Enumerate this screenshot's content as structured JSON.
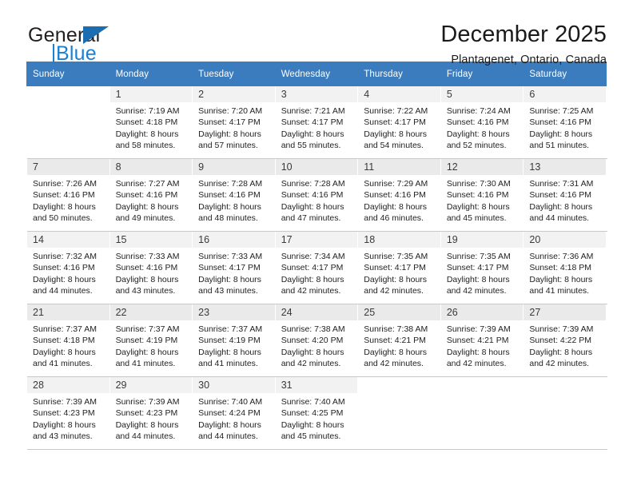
{
  "brand": {
    "name_part1": "General",
    "name_part2": "Blue",
    "triangle_color": "#1b6cb0",
    "blue_color": "#1b7fd4"
  },
  "header": {
    "title": "December 2025",
    "subtitle": "Plantagenet, Ontario, Canada"
  },
  "theme": {
    "header_bg": "#3a7cbe",
    "header_text": "#ffffff",
    "daynum_bg": "#f2f2f2",
    "daynum_bg_alt": "#eaeaea",
    "row_divider": "#c9c9c9"
  },
  "weekday_headers": [
    "Sunday",
    "Monday",
    "Tuesday",
    "Wednesday",
    "Thursday",
    "Friday",
    "Saturday"
  ],
  "weeks": [
    [
      {
        "day": "",
        "sunrise": "",
        "sunset": "",
        "daylight_line1": "",
        "daylight_line2": ""
      },
      {
        "day": "1",
        "sunrise": "Sunrise: 7:19 AM",
        "sunset": "Sunset: 4:18 PM",
        "daylight_line1": "Daylight: 8 hours",
        "daylight_line2": "and 58 minutes."
      },
      {
        "day": "2",
        "sunrise": "Sunrise: 7:20 AM",
        "sunset": "Sunset: 4:17 PM",
        "daylight_line1": "Daylight: 8 hours",
        "daylight_line2": "and 57 minutes."
      },
      {
        "day": "3",
        "sunrise": "Sunrise: 7:21 AM",
        "sunset": "Sunset: 4:17 PM",
        "daylight_line1": "Daylight: 8 hours",
        "daylight_line2": "and 55 minutes."
      },
      {
        "day": "4",
        "sunrise": "Sunrise: 7:22 AM",
        "sunset": "Sunset: 4:17 PM",
        "daylight_line1": "Daylight: 8 hours",
        "daylight_line2": "and 54 minutes."
      },
      {
        "day": "5",
        "sunrise": "Sunrise: 7:24 AM",
        "sunset": "Sunset: 4:16 PM",
        "daylight_line1": "Daylight: 8 hours",
        "daylight_line2": "and 52 minutes."
      },
      {
        "day": "6",
        "sunrise": "Sunrise: 7:25 AM",
        "sunset": "Sunset: 4:16 PM",
        "daylight_line1": "Daylight: 8 hours",
        "daylight_line2": "and 51 minutes."
      }
    ],
    [
      {
        "day": "7",
        "sunrise": "Sunrise: 7:26 AM",
        "sunset": "Sunset: 4:16 PM",
        "daylight_line1": "Daylight: 8 hours",
        "daylight_line2": "and 50 minutes."
      },
      {
        "day": "8",
        "sunrise": "Sunrise: 7:27 AM",
        "sunset": "Sunset: 4:16 PM",
        "daylight_line1": "Daylight: 8 hours",
        "daylight_line2": "and 49 minutes."
      },
      {
        "day": "9",
        "sunrise": "Sunrise: 7:28 AM",
        "sunset": "Sunset: 4:16 PM",
        "daylight_line1": "Daylight: 8 hours",
        "daylight_line2": "and 48 minutes."
      },
      {
        "day": "10",
        "sunrise": "Sunrise: 7:28 AM",
        "sunset": "Sunset: 4:16 PM",
        "daylight_line1": "Daylight: 8 hours",
        "daylight_line2": "and 47 minutes."
      },
      {
        "day": "11",
        "sunrise": "Sunrise: 7:29 AM",
        "sunset": "Sunset: 4:16 PM",
        "daylight_line1": "Daylight: 8 hours",
        "daylight_line2": "and 46 minutes."
      },
      {
        "day": "12",
        "sunrise": "Sunrise: 7:30 AM",
        "sunset": "Sunset: 4:16 PM",
        "daylight_line1": "Daylight: 8 hours",
        "daylight_line2": "and 45 minutes."
      },
      {
        "day": "13",
        "sunrise": "Sunrise: 7:31 AM",
        "sunset": "Sunset: 4:16 PM",
        "daylight_line1": "Daylight: 8 hours",
        "daylight_line2": "and 44 minutes."
      }
    ],
    [
      {
        "day": "14",
        "sunrise": "Sunrise: 7:32 AM",
        "sunset": "Sunset: 4:16 PM",
        "daylight_line1": "Daylight: 8 hours",
        "daylight_line2": "and 44 minutes."
      },
      {
        "day": "15",
        "sunrise": "Sunrise: 7:33 AM",
        "sunset": "Sunset: 4:16 PM",
        "daylight_line1": "Daylight: 8 hours",
        "daylight_line2": "and 43 minutes."
      },
      {
        "day": "16",
        "sunrise": "Sunrise: 7:33 AM",
        "sunset": "Sunset: 4:17 PM",
        "daylight_line1": "Daylight: 8 hours",
        "daylight_line2": "and 43 minutes."
      },
      {
        "day": "17",
        "sunrise": "Sunrise: 7:34 AM",
        "sunset": "Sunset: 4:17 PM",
        "daylight_line1": "Daylight: 8 hours",
        "daylight_line2": "and 42 minutes."
      },
      {
        "day": "18",
        "sunrise": "Sunrise: 7:35 AM",
        "sunset": "Sunset: 4:17 PM",
        "daylight_line1": "Daylight: 8 hours",
        "daylight_line2": "and 42 minutes."
      },
      {
        "day": "19",
        "sunrise": "Sunrise: 7:35 AM",
        "sunset": "Sunset: 4:17 PM",
        "daylight_line1": "Daylight: 8 hours",
        "daylight_line2": "and 42 minutes."
      },
      {
        "day": "20",
        "sunrise": "Sunrise: 7:36 AM",
        "sunset": "Sunset: 4:18 PM",
        "daylight_line1": "Daylight: 8 hours",
        "daylight_line2": "and 41 minutes."
      }
    ],
    [
      {
        "day": "21",
        "sunrise": "Sunrise: 7:37 AM",
        "sunset": "Sunset: 4:18 PM",
        "daylight_line1": "Daylight: 8 hours",
        "daylight_line2": "and 41 minutes."
      },
      {
        "day": "22",
        "sunrise": "Sunrise: 7:37 AM",
        "sunset": "Sunset: 4:19 PM",
        "daylight_line1": "Daylight: 8 hours",
        "daylight_line2": "and 41 minutes."
      },
      {
        "day": "23",
        "sunrise": "Sunrise: 7:37 AM",
        "sunset": "Sunset: 4:19 PM",
        "daylight_line1": "Daylight: 8 hours",
        "daylight_line2": "and 41 minutes."
      },
      {
        "day": "24",
        "sunrise": "Sunrise: 7:38 AM",
        "sunset": "Sunset: 4:20 PM",
        "daylight_line1": "Daylight: 8 hours",
        "daylight_line2": "and 42 minutes."
      },
      {
        "day": "25",
        "sunrise": "Sunrise: 7:38 AM",
        "sunset": "Sunset: 4:21 PM",
        "daylight_line1": "Daylight: 8 hours",
        "daylight_line2": "and 42 minutes."
      },
      {
        "day": "26",
        "sunrise": "Sunrise: 7:39 AM",
        "sunset": "Sunset: 4:21 PM",
        "daylight_line1": "Daylight: 8 hours",
        "daylight_line2": "and 42 minutes."
      },
      {
        "day": "27",
        "sunrise": "Sunrise: 7:39 AM",
        "sunset": "Sunset: 4:22 PM",
        "daylight_line1": "Daylight: 8 hours",
        "daylight_line2": "and 42 minutes."
      }
    ],
    [
      {
        "day": "28",
        "sunrise": "Sunrise: 7:39 AM",
        "sunset": "Sunset: 4:23 PM",
        "daylight_line1": "Daylight: 8 hours",
        "daylight_line2": "and 43 minutes."
      },
      {
        "day": "29",
        "sunrise": "Sunrise: 7:39 AM",
        "sunset": "Sunset: 4:23 PM",
        "daylight_line1": "Daylight: 8 hours",
        "daylight_line2": "and 44 minutes."
      },
      {
        "day": "30",
        "sunrise": "Sunrise: 7:40 AM",
        "sunset": "Sunset: 4:24 PM",
        "daylight_line1": "Daylight: 8 hours",
        "daylight_line2": "and 44 minutes."
      },
      {
        "day": "31",
        "sunrise": "Sunrise: 7:40 AM",
        "sunset": "Sunset: 4:25 PM",
        "daylight_line1": "Daylight: 8 hours",
        "daylight_line2": "and 45 minutes."
      },
      {
        "day": "",
        "sunrise": "",
        "sunset": "",
        "daylight_line1": "",
        "daylight_line2": ""
      },
      {
        "day": "",
        "sunrise": "",
        "sunset": "",
        "daylight_line1": "",
        "daylight_line2": ""
      },
      {
        "day": "",
        "sunrise": "",
        "sunset": "",
        "daylight_line1": "",
        "daylight_line2": ""
      }
    ]
  ]
}
